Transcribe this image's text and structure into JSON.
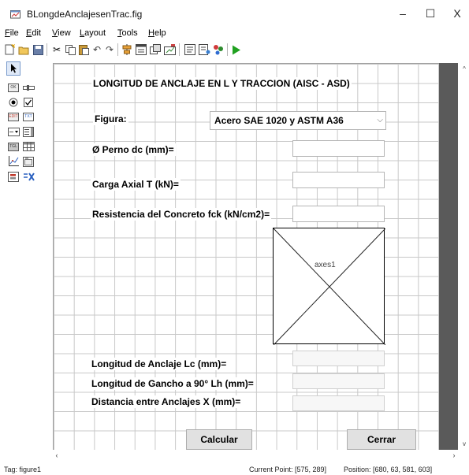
{
  "window": {
    "title": "BLongdeAnclajesenTrac.fig",
    "minimize": "–",
    "maximize": "☐",
    "close": "X"
  },
  "menu": [
    {
      "u": "F",
      "rest": "ile"
    },
    {
      "u": "E",
      "rest": "dit"
    },
    {
      "u": "V",
      "rest": "iew"
    },
    {
      "u": "L",
      "rest": "ayout"
    },
    {
      "u": "T",
      "rest": "ools"
    },
    {
      "u": "H",
      "rest": "elp"
    }
  ],
  "toolbar_icons": [
    "new-file-icon",
    "open-folder-icon",
    "save-icon",
    "cut-icon",
    "copy-icon",
    "paste-icon",
    "undo-icon",
    "redo-icon",
    "align-icon",
    "menu-editor-icon",
    "tab-order-icon",
    "toolbar-editor-icon",
    "m-file-editor-icon",
    "property-inspector-icon",
    "object-browser-icon",
    "run-icon"
  ],
  "palette_icons": [
    "select-arrow-icon",
    "push-button-icon",
    "slider-icon",
    "radio-button-icon",
    "checkbox-icon",
    "edit-text-icon",
    "static-text-icon",
    "popup-menu-icon",
    "listbox-icon",
    "toggle-button-icon",
    "table-icon",
    "axes-icon",
    "panel-icon",
    "button-group-icon",
    "activex-icon"
  ],
  "gui": {
    "title": "LONGITUD DE ANCLAJE EN L Y TRACCION (AISC - ASD)",
    "figura_label": "Figura:",
    "figura_value": "Acero SAE 1020 y ASTM A36",
    "perno_label": "Ø Perno dc (mm)=",
    "carga_label": "Carga Axial T (kN)=",
    "resistencia_label": "Resistencia del Concreto fck (kN/cm2)=",
    "axes_label": "axes1",
    "lc_label": "Longitud de Anclaje Lc (mm)=",
    "lh_label": "Longitud de Gancho a 90° Lh (mm)=",
    "x_label": "Distancia entre Anclajes X (mm)=",
    "calcular": "Calcular",
    "cerrar": "Cerrar"
  },
  "status": {
    "tag": "Tag: figure1",
    "current_point": "Current Point:  [575, 289]",
    "position": "Position: [680, 63, 581, 603]"
  },
  "colors": {
    "run_icon": "#21a121",
    "select_highlight": "#dfe9f8",
    "canvas_edge": "#5a5a5a"
  }
}
